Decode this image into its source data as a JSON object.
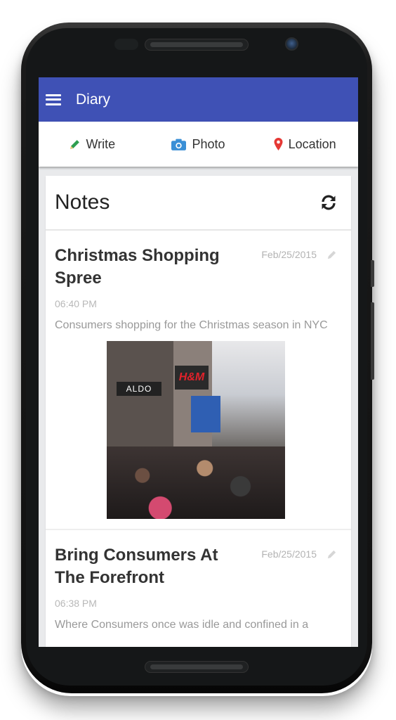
{
  "app": {
    "title": "Diary"
  },
  "toolbar": {
    "items": [
      {
        "label": "Write",
        "icon": "pencil-icon",
        "color": "#2e9e4f"
      },
      {
        "label": "Photo",
        "icon": "camera-icon",
        "color": "#3a8fd6"
      },
      {
        "label": "Location",
        "icon": "map-pin-icon",
        "color": "#e53935"
      }
    ]
  },
  "notes_card": {
    "title": "Notes",
    "refresh_icon": "refresh-icon",
    "entries": [
      {
        "title": "Christmas Shopping Spree",
        "date": "Feb/25/2015",
        "time": "06:40 PM",
        "body": "Consumers shopping for the Christmas season in NYC",
        "image": {
          "description": "Crowded shopping street with ALDO and H&M storefront signs",
          "signs": [
            "ALDO",
            "H&M"
          ]
        }
      },
      {
        "title": "Bring Consumers At The Forefront",
        "date": "Feb/25/2015",
        "time": "06:38 PM",
        "body": "Where Consumers once was idle and confined in a"
      }
    ]
  },
  "colors": {
    "appbar": "#3f51b5",
    "background": "#e9eaec",
    "muted_text": "#b3b3b3"
  }
}
